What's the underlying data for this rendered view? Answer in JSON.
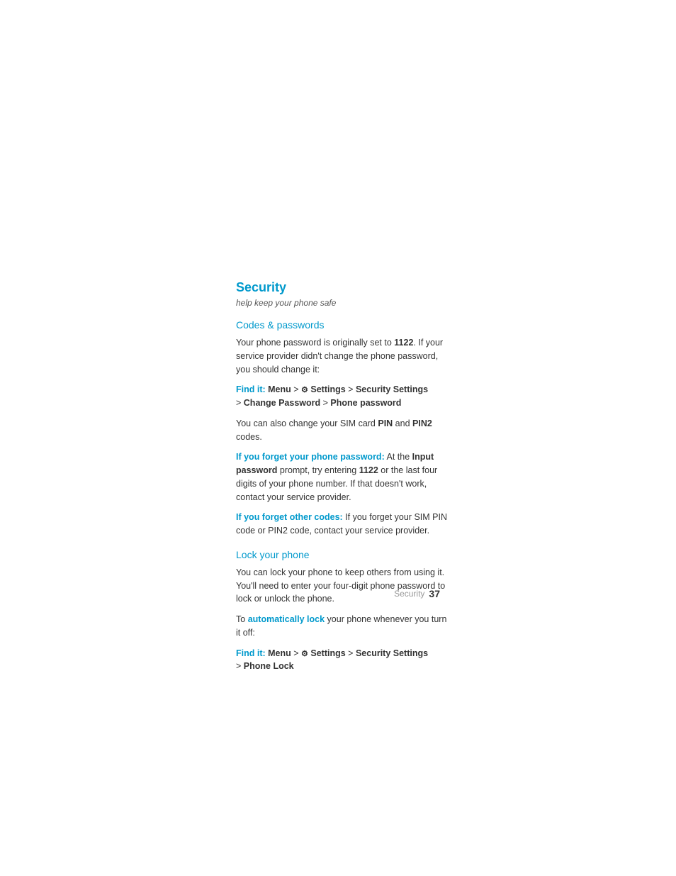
{
  "page": {
    "background": "#ffffff",
    "footer": {
      "section_name": "Security",
      "page_number": "37"
    }
  },
  "security_section": {
    "title": "Security",
    "subtitle": "help keep your phone safe",
    "codes_subsection": {
      "title": "Codes & passwords",
      "intro_text": "Your phone password is originally set to ",
      "intro_code": "1122",
      "intro_text2": ". If your service provider didn't change the phone password, you should change it:",
      "find_it_label": "Find it:",
      "find_it_menu": "Menu",
      "find_it_arrow1": " > ",
      "find_it_settings_icon": "⚙",
      "find_it_settings": " Settings",
      "find_it_arrow2": " > ",
      "find_it_security_settings": "Security Settings",
      "find_it_arrow3": " > ",
      "find_it_change_password": "Change Password",
      "find_it_arrow4": " > ",
      "find_it_phone_password": "Phone password",
      "also_text1": "You can also change your SIM card ",
      "also_pin": "PIN",
      "also_text2": " and ",
      "also_pin2": "PIN2",
      "also_text3": " codes.",
      "forgot_phone_label": "If you forget your phone password:",
      "forgot_phone_text": " At the ",
      "forgot_phone_input": "Input password",
      "forgot_phone_text2": " prompt, try entering ",
      "forgot_phone_code": "1122",
      "forgot_phone_text3": " or the last four digits of your phone number. If that doesn't work, contact your service provider.",
      "forgot_codes_label": "If you forget other codes:",
      "forgot_codes_text": " If you forget your SIM PIN code or PIN2 code, contact your service provider."
    },
    "lock_subsection": {
      "title": "Lock your phone",
      "text1": "You can lock your phone to keep others from using it. You'll need to enter your four-digit phone password to lock or unlock the phone.",
      "text2_pre": "To ",
      "text2_link": "automatically lock",
      "text2_post": " your phone whenever you turn it off:",
      "find_it_label": "Find it:",
      "find_it_menu": "Menu",
      "find_it_arrow1": " > ",
      "find_it_settings_icon": "⚙",
      "find_it_settings": " Settings",
      "find_it_arrow2": " > ",
      "find_it_security_settings": "Security Settings",
      "find_it_arrow3": " > ",
      "find_it_phone_lock": "Phone Lock"
    }
  }
}
